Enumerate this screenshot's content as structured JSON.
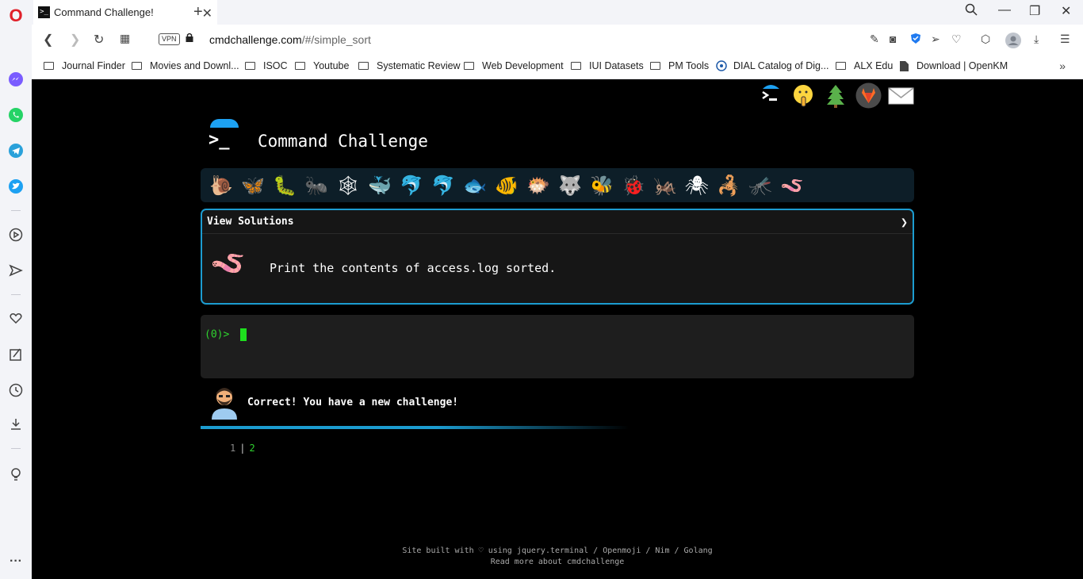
{
  "browser": {
    "tab": {
      "title": "Command Challenge!",
      "favicon_text": ">_"
    },
    "new_tab_label": "+",
    "address": {
      "vpn_label": "VPN",
      "url_host": "cmdchallenge.com",
      "url_path": "/#/simple_sort"
    },
    "bookmarks": [
      "Journal Finder",
      "Movies and Downl...",
      "ISOC",
      "Youtube",
      "Systematic Review",
      "Web Development",
      "IUI Datasets",
      "PM Tools",
      "DIAL Catalog of Dig...",
      "ALX Edu",
      "Download | OpenKM"
    ],
    "more_label": "»"
  },
  "site": {
    "title": "Command Challenge",
    "logo_glyph": ">_",
    "top_icons": [
      "terminal-icon",
      "shushing-face-icon",
      "tree-icon",
      "gitlab-icon",
      "mail-icon"
    ],
    "challenge_emojis": [
      "🐌",
      "🦋",
      "🐛",
      "🐜",
      "🕸",
      "🐳",
      "🐬",
      "🐬",
      "🐟",
      "🐠",
      "🐡",
      "🐺",
      "🐝",
      "🐞",
      "🦗",
      "🕷",
      "🦂",
      "🦟",
      "🪱"
    ],
    "card": {
      "header": "View Solutions",
      "chevron": "❯",
      "emoji": "🪱",
      "description": "Print the contents of access.log sorted."
    },
    "terminal": {
      "prompt": "(0)> "
    },
    "status": {
      "message": "Correct! You have a new challenge!"
    },
    "pager": {
      "prev": "1",
      "current": "2"
    },
    "footer": {
      "line1": "Site built with ♡ using jquery.terminal / Openmoji / Nim / Golang",
      "line2": "Read more about cmdchallenge"
    },
    "colors": {
      "accent": "#1c9cd0",
      "prompt": "#2fd32f",
      "background": "#000000"
    }
  }
}
